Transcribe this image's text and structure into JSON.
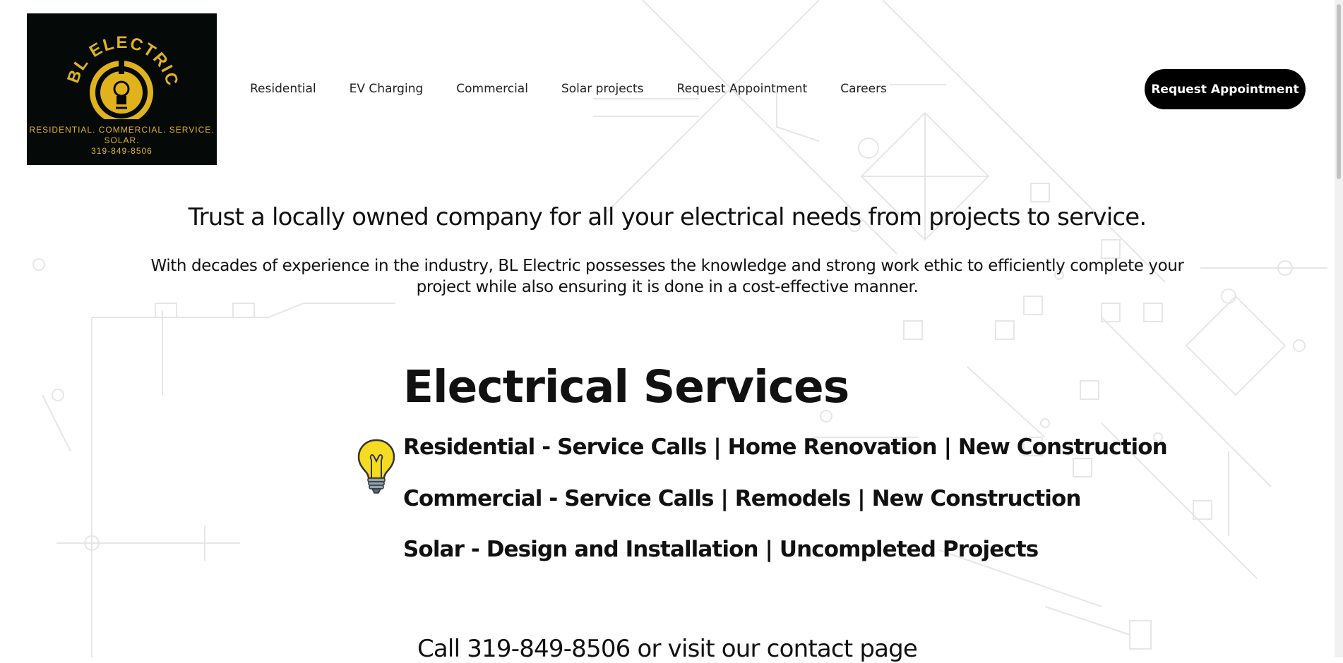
{
  "logo": {
    "brand": "BL ELECTRIC",
    "tagline": "RESIDENTIAL. COMMERCIAL. SERVICE. SOLAR.",
    "phone": "319-849-8506",
    "colors": {
      "background": "#050907",
      "gold": "#e0b31c"
    }
  },
  "nav": {
    "items": [
      {
        "label": "Residential"
      },
      {
        "label": "EV Charging"
      },
      {
        "label": "Commercial"
      },
      {
        "label": "Solar projects"
      },
      {
        "label": "Request Appointment"
      },
      {
        "label": "Careers"
      }
    ],
    "cta_label": "Request Appointment"
  },
  "hero": {
    "headline": "Trust a locally owned company for all your electrical needs from projects to service.",
    "intro": "With decades of experience in the industry, BL Electric possesses the knowledge and strong work ethic to efficiently complete your project while also ensuring it is done in a cost-effective manner."
  },
  "services": {
    "title": "Electrical Services",
    "lines": [
      "Residential - Service Calls | Home Renovation | New Construction",
      "Commercial - Service Calls | Remodels | New Construction",
      "Solar - Design and Installation | Uncompleted Projects"
    ],
    "icon": "lightbulb-icon"
  },
  "call_text": "Call 319-849-8506 or visit our contact page",
  "colors": {
    "accent": "#000000",
    "bulb": "#f5dc22"
  }
}
